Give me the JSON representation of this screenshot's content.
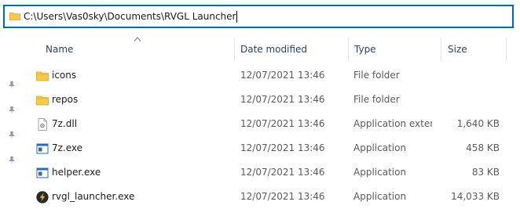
{
  "address": {
    "path": "C:\\Users\\Vas0sky\\Documents\\RVGL Launcher"
  },
  "columns": {
    "name": "Name",
    "date_modified": "Date modified",
    "type": "Type",
    "size": "Size"
  },
  "files": [
    {
      "name": "icons",
      "date": "12/07/2021 13:46",
      "type": "File folder",
      "size": "",
      "icon": "folder-icon"
    },
    {
      "name": "repos",
      "date": "12/07/2021 13:46",
      "type": "File folder",
      "size": "",
      "icon": "folder-icon"
    },
    {
      "name": "7z.dll",
      "date": "12/07/2021 13:46",
      "type": "Application exten…",
      "size": "1,640 KB",
      "icon": "dll-file-icon"
    },
    {
      "name": "7z.exe",
      "date": "12/07/2021 13:46",
      "type": "Application",
      "size": "458 KB",
      "icon": "exe-app-icon"
    },
    {
      "name": "helper.exe",
      "date": "12/07/2021 13:46",
      "type": "Application",
      "size": "83 KB",
      "icon": "exe-app-icon"
    },
    {
      "name": "rvgl_launcher.exe",
      "date": "12/07/2021 13:46",
      "type": "Application",
      "size": "14,033 KB",
      "icon": "rvgl-launcher-icon"
    }
  ],
  "colors": {
    "accent": "#0067c0",
    "folder": "#f8c84a",
    "header_text": "#2c4360"
  }
}
